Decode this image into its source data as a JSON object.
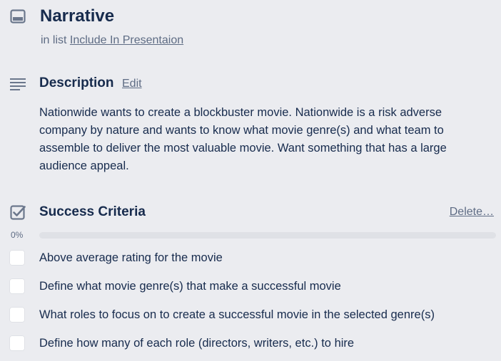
{
  "card": {
    "title": "Narrative",
    "list_prefix": "in list",
    "list_name": "Include In Presentaion"
  },
  "description": {
    "heading": "Description",
    "edit_label": "Edit",
    "text": "Nationwide wants to create a blockbuster movie. Nationwide is a risk adverse company by nature and wants to know what movie genre(s) and what team to assemble to deliver the most valuable movie. Want something that has a large audience appeal."
  },
  "checklist": {
    "title": "Success Criteria",
    "delete_label": "Delete…",
    "progress_label": "0%",
    "progress_fraction": 0,
    "items": [
      {
        "label": "Above average rating for the movie",
        "checked": false
      },
      {
        "label": "Define what movie genre(s) that make a successful movie",
        "checked": false
      },
      {
        "label": "What roles to focus on to create a successful movie in the selected genre(s)",
        "checked": false
      },
      {
        "label": "Define how many of each role (directors, writers, etc.) to hire",
        "checked": false
      }
    ]
  },
  "icons": {
    "card": "card-icon",
    "description": "description-lines-icon",
    "checklist": "checklist-icon"
  },
  "colors": {
    "background": "#ebecf0",
    "text": "#172b4d",
    "muted": "#5e6c84",
    "icon": "#6b778c",
    "progress_track": "#dfe1e6",
    "progress_fill": "#61bd4f"
  }
}
